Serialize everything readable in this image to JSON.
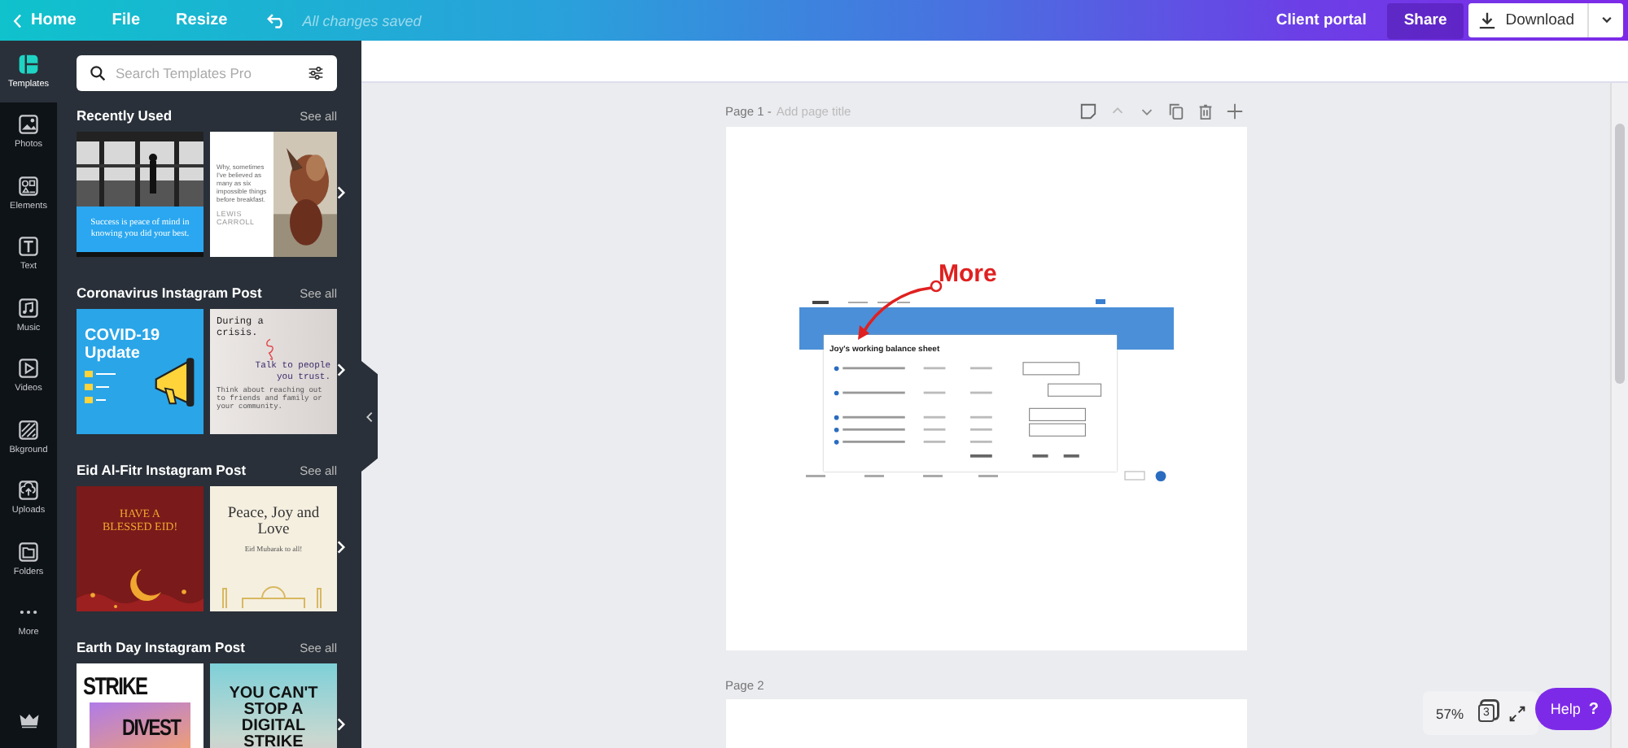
{
  "topbar": {
    "nav": [
      {
        "label": "Home",
        "kind": "back"
      },
      {
        "label": "File",
        "kind": "menu"
      },
      {
        "label": "Resize",
        "kind": "menu"
      }
    ],
    "save_status": "All changes saved",
    "client_portal": "Client portal",
    "share": "Share",
    "download": "Download"
  },
  "rail": {
    "items": [
      {
        "label": "Templates",
        "kind": "templates",
        "selected": true
      },
      {
        "label": "Photos",
        "kind": "photos",
        "selected": false
      },
      {
        "label": "Elements",
        "kind": "elements",
        "selected": false
      },
      {
        "label": "Text",
        "kind": "text",
        "selected": false
      },
      {
        "label": "Music",
        "kind": "music",
        "selected": false
      },
      {
        "label": "Videos",
        "kind": "videos",
        "selected": false
      },
      {
        "label": "Bkground",
        "kind": "background",
        "selected": false
      },
      {
        "label": "Uploads",
        "kind": "uploads",
        "selected": false
      },
      {
        "label": "Folders",
        "kind": "folders",
        "selected": false
      },
      {
        "label": "More",
        "kind": "more",
        "selected": false
      }
    ]
  },
  "search": {
    "placeholder": "Search Templates Pro"
  },
  "sections": [
    {
      "title": "Recently Used",
      "see_all": "See all",
      "templates": [
        {
          "kind": "photo-quote",
          "texts": [
            "Success is peace of mind in knowing you did your best."
          ]
        },
        {
          "kind": "quote-photo",
          "texts": [
            "Why, sometimes I've believed as many as six impossible things before breakfast.",
            "LEWIS CARROLL"
          ]
        }
      ]
    },
    {
      "title": "Coronavirus Instagram Post",
      "see_all": "See all",
      "templates": [
        {
          "kind": "covid",
          "texts": [
            "COVID-19 Update"
          ]
        },
        {
          "kind": "crisis",
          "texts": [
            "During a crisis.",
            "Talk to people you trust.",
            "Think about reaching out to friends and family or your community."
          ]
        }
      ]
    },
    {
      "title": "Eid Al-Fitr Instagram Post",
      "see_all": "See all",
      "templates": [
        {
          "kind": "eid-red",
          "texts": [
            "HAVE A BLESSED EID!"
          ]
        },
        {
          "kind": "eid-cream",
          "texts": [
            "Peace, Joy and Love",
            "Eid Mubarak to all!"
          ]
        }
      ]
    },
    {
      "title": "Earth Day Instagram Post",
      "see_all": "See all",
      "templates": [
        {
          "kind": "strike",
          "texts": [
            "STRIKE",
            "DIVEST"
          ]
        },
        {
          "kind": "digital",
          "texts": [
            "YOU CAN'T STOP A DIGITAL STRIKE"
          ]
        }
      ]
    }
  ],
  "pages": [
    {
      "label": "Page 1 -",
      "title_placeholder": "Add page title",
      "annotation": "More",
      "heading": "Joy's working balance sheet"
    },
    {
      "label": "Page 2"
    }
  ],
  "zoom": {
    "percent": "57%",
    "page_count": "3"
  },
  "help": {
    "label": "Help",
    "icon": "?"
  }
}
